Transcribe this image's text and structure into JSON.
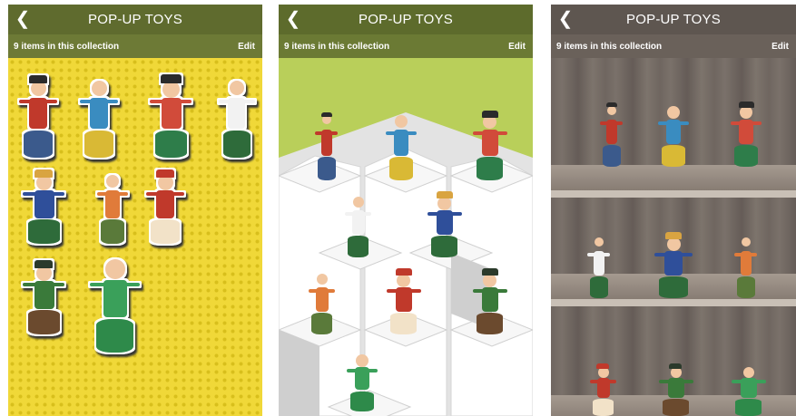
{
  "screens": [
    {
      "id": "halftone",
      "nav": {
        "back_icon": "chevron-left-icon",
        "title": "POP-UP TOYS"
      },
      "subbar": {
        "count_text": "9 items in this collection",
        "edit_label": "Edit"
      }
    },
    {
      "id": "hexagon",
      "nav": {
        "back_icon": "chevron-left-icon",
        "title": "POP-UP TOYS"
      },
      "subbar": {
        "count_text": "9 items in this collection",
        "edit_label": "Edit"
      }
    },
    {
      "id": "shelves",
      "nav": {
        "back_icon": "chevron-left-icon",
        "title": "POP-UP TOYS"
      },
      "subbar": {
        "count_text": "9 items in this collection",
        "edit_label": "Edit"
      }
    }
  ],
  "toys": [
    {
      "name": "toy-pirate",
      "base": "#3b5a8c",
      "body": "#c0392b",
      "hat": "#2b2b2b"
    },
    {
      "name": "toy-weightlifter",
      "base": "#d9b935",
      "body": "#3a8cc0",
      "hat": ""
    },
    {
      "name": "toy-strongman",
      "base": "#2e7d4a",
      "body": "#d14b3a",
      "hat": "#2b2b2b"
    },
    {
      "name": "toy-zebra",
      "base": "#2e6b3a",
      "body": "#f2f2f2",
      "hat": ""
    },
    {
      "name": "toy-scarecrow",
      "base": "#2e6b3a",
      "body": "#2f4f9a",
      "hat": "#d9a441"
    },
    {
      "name": "toy-giraffe",
      "base": "#5a7a3a",
      "body": "#e07b3a",
      "hat": ""
    },
    {
      "name": "toy-clown",
      "base": "#f2e2c8",
      "body": "#c0392b",
      "hat": "#c0392b"
    },
    {
      "name": "toy-soldier",
      "base": "#6b4a2e",
      "body": "#3a7a3a",
      "hat": "#2b3a2b"
    },
    {
      "name": "toy-frogs",
      "base": "#2e8a4a",
      "body": "#3aa05a",
      "hat": ""
    }
  ]
}
